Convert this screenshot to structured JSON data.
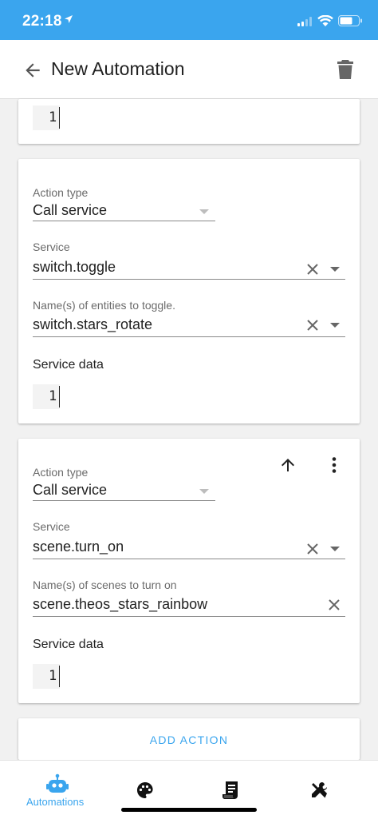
{
  "status_bar": {
    "time": "22:18"
  },
  "app_bar": {
    "title": "New Automation"
  },
  "card1": {
    "service_data_value": "1"
  },
  "card2": {
    "action_type_label": "Action type",
    "action_type_value": "Call service",
    "service_label": "Service",
    "service_value": "switch.toggle",
    "entities_label": "Name(s) of entities to toggle.",
    "entities_value": "switch.stars_rotate",
    "service_data_label": "Service data",
    "service_data_value": "1"
  },
  "card3": {
    "action_type_label": "Action type",
    "action_type_value": "Call service",
    "service_label": "Service",
    "service_value": "scene.turn_on",
    "entities_label": "Name(s) of scenes to turn on",
    "entities_value": "scene.theos_stars_rainbow",
    "service_data_label": "Service data",
    "service_data_value": "1"
  },
  "add_action_label": "ADD ACTION",
  "tabs": [
    {
      "label": "Automations",
      "icon": "robot-icon",
      "active": true
    },
    {
      "label": "",
      "icon": "palette-icon"
    },
    {
      "label": "",
      "icon": "script-icon"
    },
    {
      "label": "",
      "icon": "tools-icon"
    }
  ],
  "colors": {
    "accent": "#3aa5ee",
    "header": "#3aa5ee"
  }
}
